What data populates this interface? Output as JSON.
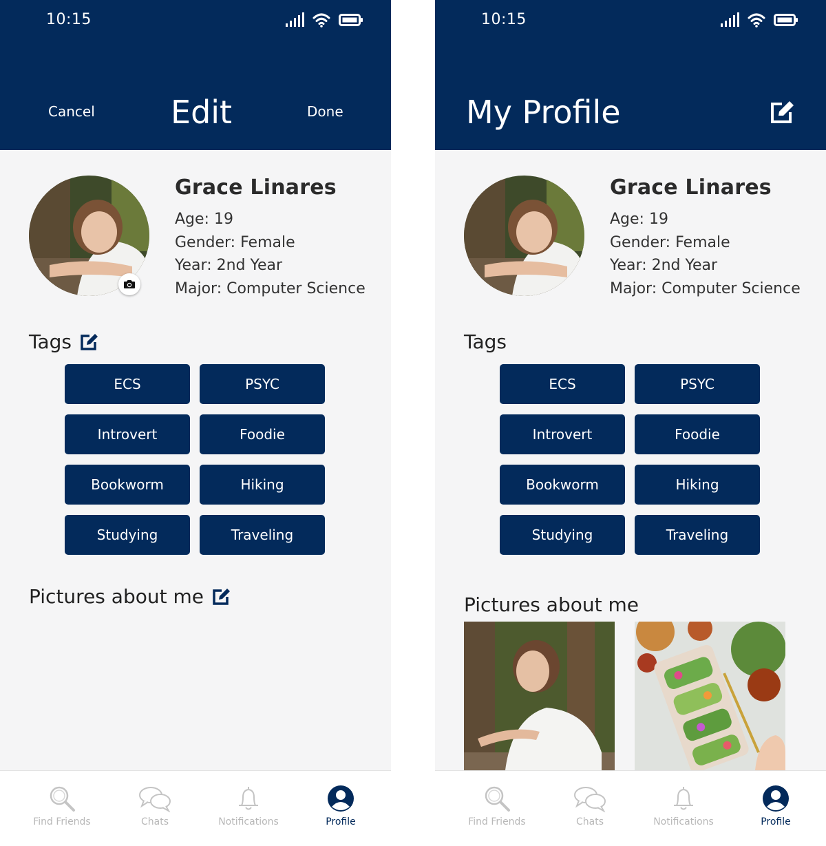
{
  "colors": {
    "brand": "#032a5b",
    "background": "#f5f5f6",
    "inactive_tab": "#b8b8b8"
  },
  "edit_screen": {
    "status_time": "10:15",
    "header": {
      "cancel_label": "Cancel",
      "title": "Edit",
      "done_label": "Done"
    },
    "profile": {
      "name": "Grace Linares",
      "age": "Age: 19",
      "gender": "Gender: Female",
      "year": "Year: 2nd Year",
      "major": "Major: Computer Science"
    },
    "tags_title": "Tags",
    "tags": [
      "ECS",
      "PSYC",
      "Introvert",
      "Foodie",
      "Bookworm",
      "Hiking",
      "Studying",
      "Traveling"
    ],
    "pictures_title": "Pictures about me"
  },
  "profile_screen": {
    "status_time": "10:15",
    "header": {
      "title": "My Profile"
    },
    "profile": {
      "name": "Grace Linares",
      "age": "Age: 19",
      "gender": "Gender: Female",
      "year": "Year: 2nd Year",
      "major": "Major: Computer Science"
    },
    "tags_title": "Tags",
    "tags": [
      "ECS",
      "PSYC",
      "Introvert",
      "Foodie",
      "Bookworm",
      "Hiking",
      "Studying",
      "Traveling"
    ],
    "pictures_title": "Pictures about me"
  },
  "tabbar": {
    "items": [
      {
        "label": "Find Friends",
        "icon": "search-icon"
      },
      {
        "label": "Chats",
        "icon": "chat-bubbles-icon"
      },
      {
        "label": "Notifications",
        "icon": "bell-icon"
      },
      {
        "label": "Profile",
        "icon": "user-circle-icon",
        "active": true
      }
    ]
  }
}
